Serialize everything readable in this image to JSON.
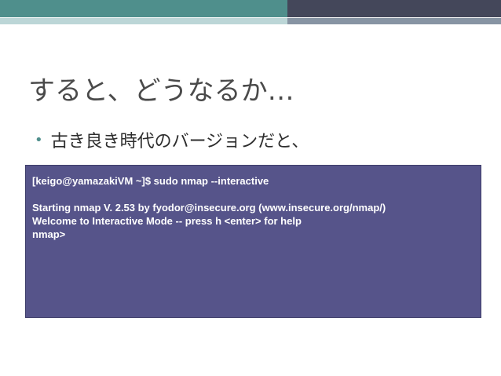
{
  "theme": {
    "band_teal": "#4f8f8c",
    "band_dark": "#44475a",
    "terminal_bg": "#56548a",
    "terminal_text": "#ffffff"
  },
  "slide": {
    "title": "すると、どうなるか…",
    "bullet_icon": "bullet-dot",
    "bullet": "古き良き時代のバージョンだと、"
  },
  "terminal": {
    "lines": [
      "[keigo@yamazakiVM ~]$ sudo nmap --interactive",
      "",
      "Starting nmap V. 2.53 by fyodor@insecure.org (www.insecure.org/nmap/)",
      "Welcome to Interactive Mode -- press h <enter> for help",
      "nmap>"
    ]
  }
}
